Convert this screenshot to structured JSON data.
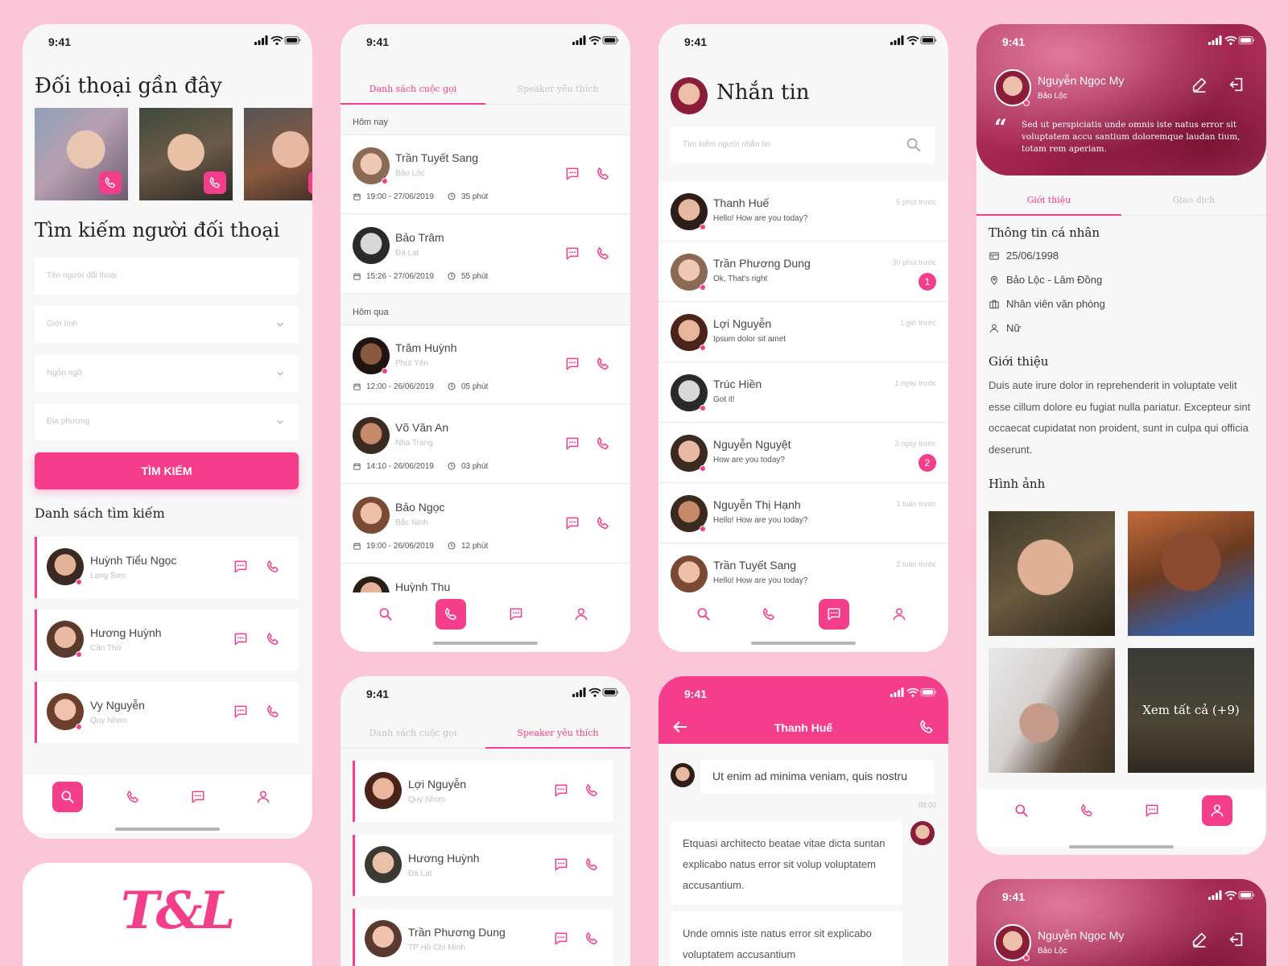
{
  "status": {
    "time": "9:41"
  },
  "colors": {
    "accent": "#f53e8b",
    "background": "#fcc6d9"
  },
  "search_screen": {
    "recent_title": "Đối thoại gần đây",
    "search_title": "Tìm kiếm người đối thoại",
    "name_placeholder": "Tên người đối thoại",
    "gender_label": "Giới tính",
    "language_label": "Ngôn ngữ",
    "location_label": "Địa phương",
    "search_button": "TÌM KIẾM",
    "results_title": "Danh sách tìm kiếm",
    "results": [
      {
        "name": "Huỳnh Tiểu Ngọc",
        "place": "Lạng Sơn"
      },
      {
        "name": "Hương Huỳnh",
        "place": "Cần Thơ"
      },
      {
        "name": "Vy Nguyễn",
        "place": "Quy Nhơn"
      }
    ]
  },
  "logo": {
    "text": "T&L"
  },
  "calls_screen": {
    "tab_calls": "Danh sách cuộc gọi",
    "tab_favorites": "Speaker yêu thích",
    "today": "Hôm nay",
    "yesterday": "Hôm qua",
    "calls": [
      {
        "name": "Trần Tuyết Sang",
        "place": "Bảo Lộc",
        "datetime": "19:00 - 27/06/2019",
        "duration": "35 phút"
      },
      {
        "name": "Bảo Trâm",
        "place": "Đà Lạt",
        "datetime": "15:26 - 27/06/2019",
        "duration": "55 phút"
      },
      {
        "name": "Trâm Huỳnh",
        "place": "Phút Yên",
        "datetime": "12:00 - 26/06/2019",
        "duration": "05 phút"
      },
      {
        "name": "Võ Văn An",
        "place": "Nha Trang",
        "datetime": "14:10 - 26/06/2019",
        "duration": "03 phút"
      },
      {
        "name": "Bảo Ngọc",
        "place": "Bắc Ninh",
        "datetime": "19:00 - 26/06/2019",
        "duration": "12 phút"
      },
      {
        "name": "Huỳnh Thu"
      }
    ]
  },
  "favorites_screen": {
    "favorites": [
      {
        "name": "Lợi Nguyễn",
        "place": "Quy Nhơn"
      },
      {
        "name": "Hương Huỳnh",
        "place": "Đà Lạt"
      },
      {
        "name": "Trần Phương Dung",
        "place": "TP Hồ Chí Minh"
      }
    ]
  },
  "messages_screen": {
    "title": "Nhắn tin",
    "search_placeholder": "Tìm kiếm người nhắn tin",
    "threads": [
      {
        "name": "Thanh Huế",
        "preview": "Hello! How are you today?",
        "time": "5 phút trước",
        "badge": ""
      },
      {
        "name": "Trần Phương Dung",
        "preview": "Ok, That's right",
        "time": "30 phút trước",
        "badge": "1"
      },
      {
        "name": "Lợi Nguyễn",
        "preview": "Ipsum dolor sit amet",
        "time": "1 giờ trước",
        "badge": ""
      },
      {
        "name": "Trúc Hiền",
        "preview": "Got it!",
        "time": "1 ngày trước",
        "badge": ""
      },
      {
        "name": "Nguyễn Nguyệt",
        "preview": "How are you today?",
        "time": "3 ngày trước",
        "badge": "2"
      },
      {
        "name": "Nguyễn Thị Hạnh",
        "preview": "Hello! How are you today?",
        "time": "1 tuần trước",
        "badge": ""
      },
      {
        "name": "Trần Tuyết Sang",
        "preview": "Hello! How are you today?",
        "time": "2 tuần trước",
        "badge": ""
      }
    ]
  },
  "chat_screen": {
    "title": "Thanh Huế",
    "msg1": "Ut enim ad minima veniam, quis nostru",
    "msg1_time": "08:00",
    "msg2": "Etquasi architecto beatae vitae dicta suntan explicabo natus error sit volup voluptatem accusantium.",
    "msg3": "Unde omnis iste natus error sit explicabo voluptatem accusantium"
  },
  "profile_screen": {
    "name": "Nguyễn Ngọc My",
    "location": "Bảo Lộc",
    "quote": "Sed ut perspiciatis unde omnis iste natus error sit voluptatem accu santium doloremque laudan tium, totam rem aperiam.",
    "tab_about": "Giới thiệu",
    "tab_transactions": "Giao dịch",
    "personal_title": "Thông tin cá nhân",
    "birthday": "25/06/1998",
    "address": "Bảo Lộc - Lâm Đồng",
    "job": "Nhân viên văn phòng",
    "gender": "Nữ",
    "about_title": "Giới thiệu",
    "about_text": "Duis aute irure dolor in reprehenderit in voluptate velit esse cillum dolore eu fugiat nulla pariatur. Excepteur sint occaecat cupidatat non proident, sunt in culpa qui officia deserunt.",
    "photos_title": "Hình ảnh",
    "see_all": "Xem tất cả (+9)"
  },
  "icons": [
    "search-icon",
    "phone-icon",
    "message-icon",
    "user-icon",
    "edit-icon",
    "logout-icon",
    "calendar-icon",
    "clock-icon",
    "chevron-down-icon",
    "back-arrow-icon",
    "quote-icon",
    "location-icon",
    "briefcase-icon",
    "card-icon"
  ]
}
